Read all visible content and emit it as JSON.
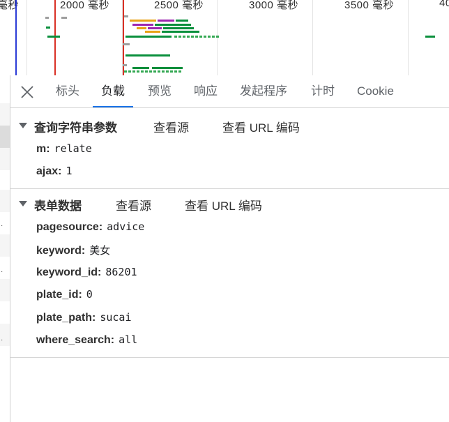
{
  "timeline": {
    "ticks": [
      {
        "label": "毫秒"
      },
      {
        "label": "2000 毫秒"
      },
      {
        "label": "2500 毫秒"
      },
      {
        "label": "3000 毫秒"
      },
      {
        "label": "3500 毫秒"
      },
      {
        "label": "40"
      }
    ],
    "colors": {
      "waiting": "#0a8f3c",
      "receiving": "#34a853",
      "script": "#e8a317",
      "purple": "#9c27b0",
      "dom_line": "#2b3bd6",
      "load_line": "#d93025"
    }
  },
  "tabs": [
    {
      "label": "标头"
    },
    {
      "label": "负载",
      "active": true
    },
    {
      "label": "预览"
    },
    {
      "label": "响应"
    },
    {
      "label": "发起程序"
    },
    {
      "label": "计时"
    },
    {
      "label": "Cookie"
    }
  ],
  "query_section": {
    "title": "查询字符串参数",
    "view_source": "查看源",
    "view_url_encoded": "查看 URL 编码",
    "params": [
      {
        "key": "m:",
        "value": "relate"
      },
      {
        "key": "ajax:",
        "value": "1"
      }
    ]
  },
  "form_section": {
    "title": "表单数据",
    "view_source": "查看源",
    "view_url_encoded": "查看 URL 编码",
    "params": [
      {
        "key": "pagesource:",
        "value": "advice"
      },
      {
        "key": "keyword:",
        "value": "美女"
      },
      {
        "key": "keyword_id:",
        "value": "86201"
      },
      {
        "key": "plate_id:",
        "value": "0"
      },
      {
        "key": "plate_path:",
        "value": "sucai"
      },
      {
        "key": "where_search:",
        "value": "all"
      }
    ]
  }
}
